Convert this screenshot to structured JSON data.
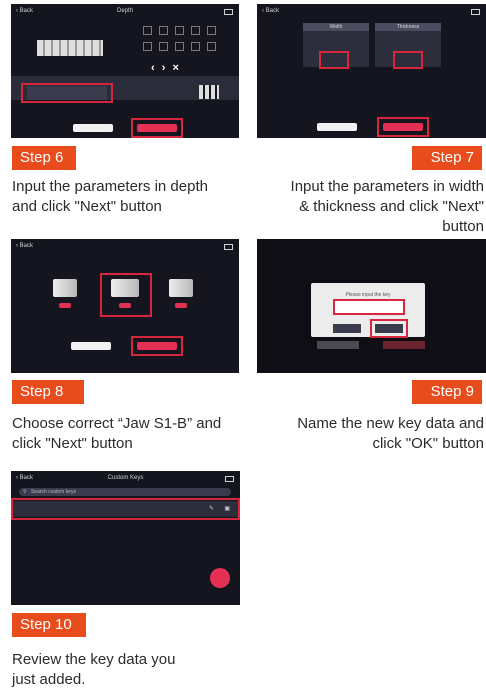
{
  "shots": {
    "s6": {
      "back": "Back",
      "title": "Depth",
      "nav": "‹  ›  ×"
    },
    "s7": {
      "back": "Back",
      "col1": "Width",
      "col2": "Thickness"
    },
    "s8": {
      "back": "Back"
    },
    "s9": {
      "prompt": "Please input the key"
    },
    "s10": {
      "back": "Back",
      "title": "Custom Keys",
      "search": "Search custom keys"
    }
  },
  "steps": [
    {
      "label": "Step 6",
      "caption": "Input the parameters in depth and click \"Next\" button"
    },
    {
      "label": "Step 7",
      "caption": "Input the parameters in width & thickness and click \"Next\" button"
    },
    {
      "label": "Step 8",
      "caption": "Choose correct “Jaw S1-B” and click \"Next\" button"
    },
    {
      "label": "Step 9",
      "caption": "Name the new key data and click \"OK\" button"
    },
    {
      "label": "Step 10",
      "caption": "Review the key data you just added."
    }
  ],
  "colors": {
    "accent": "#e84b1c",
    "highlight": "#d7263d",
    "screen": "#15151f"
  }
}
